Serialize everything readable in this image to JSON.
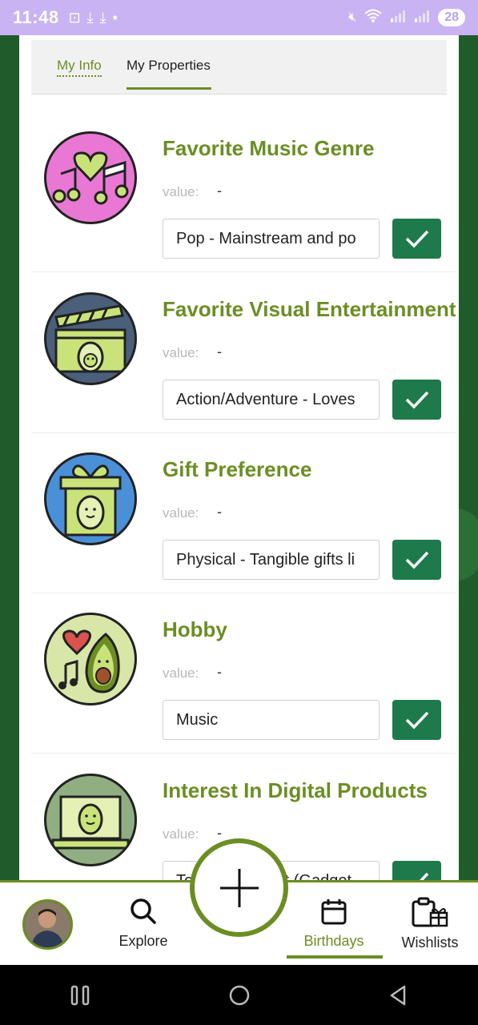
{
  "status_bar": {
    "time": "11:48",
    "battery": "28",
    "icons": [
      "screenshot-icon",
      "download-icon",
      "download-icon",
      "dot-icon",
      "mute-icon",
      "wifi-icon",
      "signal-icon",
      "signal-icon"
    ]
  },
  "tabs": [
    {
      "label": "My Info",
      "active": false
    },
    {
      "label": "My Properties",
      "active": true
    }
  ],
  "properties": [
    {
      "title": "Favorite Music Genre",
      "value_label": "value:",
      "value": "-",
      "input_value": "Pop - Mainstream and po",
      "icon": "music-heart-icon",
      "icon_bg": "#e878d3"
    },
    {
      "title": "Favorite Visual Entertainment",
      "value_label": "value:",
      "value": "-",
      "input_value": "Action/Adventure - Loves",
      "icon": "clapperboard-icon",
      "icon_bg": "#4a5f7a"
    },
    {
      "title": "Gift Preference",
      "value_label": "value:",
      "value": "-",
      "input_value": "Physical - Tangible gifts li",
      "icon": "gift-box-icon",
      "icon_bg": "#4a90d9"
    },
    {
      "title": "Hobby",
      "value_label": "value:",
      "value": "-",
      "input_value": "Music",
      "icon": "heart-avocado-icon",
      "icon_bg": "#d8e6a8"
    },
    {
      "title": "Interest In Digital Products",
      "value_label": "value:",
      "value": "-",
      "input_value": "Tech Enthusiast (Gadget",
      "icon": "laptop-avocado-icon",
      "icon_bg": "#8fae82"
    }
  ],
  "bottom_nav": {
    "explore": "Explore",
    "birthdays": "Birthdays",
    "wishlists": "Wishlists",
    "active": "Birthdays"
  },
  "colors": {
    "accent": "#6b8e23",
    "confirm": "#1e7a4a",
    "status_bar": "#c9b3f2"
  }
}
